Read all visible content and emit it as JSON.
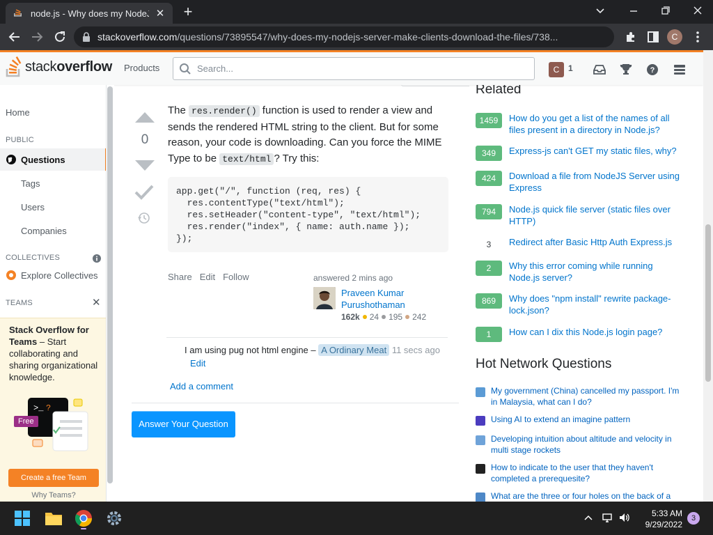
{
  "browser": {
    "tab_title": "node.js - Why does my NodeJS S",
    "url_domain": "stackoverflow.com",
    "url_path": "/questions/73895547/why-does-my-nodejs-server-make-clients-download-the-files/738...",
    "profile_initial": "C"
  },
  "header": {
    "logo_light": "stack",
    "logo_bold": "overflow",
    "products": "Products",
    "search_placeholder": "Search...",
    "avatar_initial": "C",
    "reputation": "1"
  },
  "leftnav": {
    "home": "Home",
    "public": "PUBLIC",
    "questions": "Questions",
    "tags": "Tags",
    "users": "Users",
    "companies": "Companies",
    "collectives": "COLLECTIVES",
    "explore": "Explore Collectives",
    "teams": "TEAMS",
    "teams_title": "Stack Overflow for Teams",
    "teams_body": "– Start collaborating and sharing organizational knowledge.",
    "free": "Free",
    "create_team": "Create a free Team",
    "why_teams": "Why Teams?"
  },
  "answer": {
    "votes": "0",
    "text_1": "The ",
    "code_1": "res.render()",
    "text_2": " function is used to render a view and sends the rendered HTML string to the client. But for some reason, your code is downloading. Can you force the MIME Type to be ",
    "code_2": "text/html",
    "text_3": "? Try this:",
    "code_lines": [
      "app.get(\"/\", function (req, res) {",
      "  res.contentType(\"text/html\");",
      "  res.setHeader(\"content-type\", \"text/html\");",
      "  res.render(\"index\", { name: auth.name });",
      "});"
    ],
    "share": "Share",
    "edit": "Edit",
    "follow": "Follow",
    "answered": "answered 2 mins ago",
    "user_name": "Praveen Kumar Purushothaman",
    "user_rep": "162k",
    "gold": "24",
    "silver": "195",
    "bronze": "242",
    "comment_text": "I am using pug not html engine –",
    "comment_user": "A Ordinary Meat",
    "comment_time": "11 secs ago",
    "comment_edit": "Edit",
    "add_comment": "Add a comment",
    "answer_button": "Answer Your Question"
  },
  "related": {
    "heading": "Related",
    "items": [
      {
        "score": "1459",
        "accepted": true,
        "title": "How do you get a list of the names of all files present in a directory in Node.js?"
      },
      {
        "score": "349",
        "accepted": true,
        "title": "Express-js can't GET my static files, why?"
      },
      {
        "score": "424",
        "accepted": true,
        "title": "Download a file from NodeJS Server using Express"
      },
      {
        "score": "794",
        "accepted": true,
        "title": "Node.js quick file server (static files over HTTP)"
      },
      {
        "score": "3",
        "accepted": false,
        "title": "Redirect after Basic Http Auth Express.js"
      },
      {
        "score": "2",
        "accepted": true,
        "title": "Why this error coming while running Node.js server?"
      },
      {
        "score": "869",
        "accepted": true,
        "title": "Why does \"npm install\" rewrite package-lock.json?"
      },
      {
        "score": "1",
        "accepted": true,
        "title": "How can I dix this Node.js login page?"
      }
    ]
  },
  "hot": {
    "heading": "Hot Network Questions",
    "items": [
      {
        "site": "travel",
        "icon_color": "#5b9bd5",
        "title": "My government (China) cancelled my passport. I'm in Malaysia, what can I do?"
      },
      {
        "site": "ai",
        "icon_color": "#4b3cbf",
        "title": "Using AI to extend an imagine pattern"
      },
      {
        "site": "physics",
        "icon_color": "#6fa3d9",
        "title": "Developing intuition about altitude and velocity in multi stage rockets"
      },
      {
        "site": "ux",
        "icon_color": "#222222",
        "title": "How to indicate to the user that they haven't completed a prerequesite?"
      },
      {
        "site": "blender",
        "icon_color": "#4e88c7",
        "title": "What are the three or four holes on the back of a"
      }
    ]
  },
  "taskbar": {
    "time": "5:33 AM",
    "date": "9/29/2022",
    "notifications": "3"
  }
}
